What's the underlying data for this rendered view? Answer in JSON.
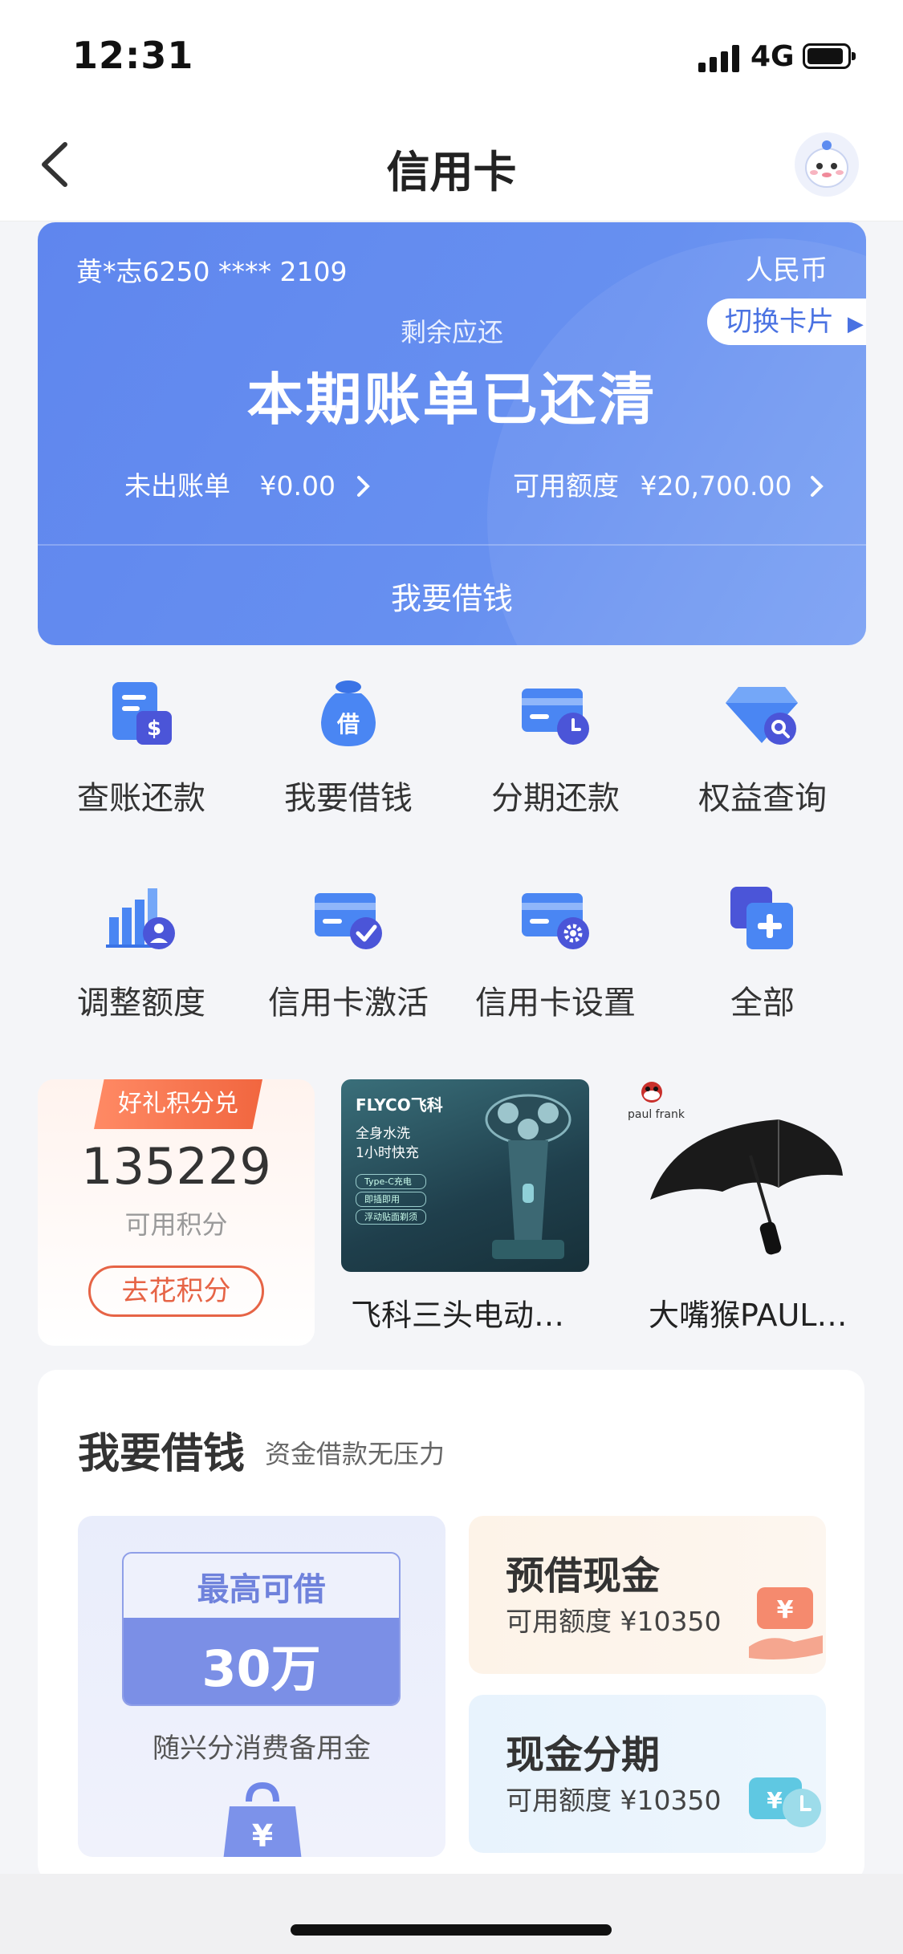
{
  "status": {
    "time": "12:31",
    "network": "4G"
  },
  "nav": {
    "title": "信用卡"
  },
  "card": {
    "number": "黄*志6250 **** 2109",
    "currency": "人民币",
    "switch_label": "切换卡片",
    "remain_label": "剩余应还",
    "status_text": "本期账单已还清",
    "unbilled_label": "未出账单",
    "unbilled_value": "¥0.00",
    "available_label": "可用额度",
    "available_value": "¥20,700.00",
    "borrow_label": "我要借钱"
  },
  "grid": [
    {
      "label": "查账还款",
      "icon": "bill-icon"
    },
    {
      "label": "我要借钱",
      "icon": "money-bag-icon"
    },
    {
      "label": "分期还款",
      "icon": "card-clock-icon"
    },
    {
      "label": "权益查询",
      "icon": "diamond-search-icon"
    },
    {
      "label": "调整额度",
      "icon": "chart-user-icon"
    },
    {
      "label": "信用卡激活",
      "icon": "card-check-icon"
    },
    {
      "label": "信用卡设置",
      "icon": "card-gear-icon"
    },
    {
      "label": "全部",
      "icon": "plus-squares-icon"
    }
  ],
  "points": {
    "badge": "好礼积分兑",
    "value": "135229",
    "label": "可用积分",
    "button": "去花积分"
  },
  "products": [
    {
      "name": "飞科三头电动…",
      "brand": "FLYCO飞科",
      "lines": [
        "全身水洗",
        "1小时快充"
      ],
      "tags": [
        "Type-C充电",
        "即插即用",
        "浮动贴面剃须"
      ]
    },
    {
      "name": "大嘴猴PAUL…",
      "brand": "paul frank"
    }
  ],
  "loan": {
    "title": "我要借钱",
    "subtitle": "资金借款无压力",
    "max_label": "最高可借",
    "max_value": "30万",
    "desc": "随兴分消费备用金",
    "cards": [
      {
        "title": "预借现金",
        "sub": "可用额度 ¥10350",
        "bg": "#fdf4ea"
      },
      {
        "title": "现金分期",
        "sub": "可用额度 ¥10350",
        "bg": "#eaf4fc"
      }
    ]
  },
  "colors": {
    "primary": "#6089ee",
    "accent": "#e66446",
    "grid_icon": "#3f7cf0"
  }
}
